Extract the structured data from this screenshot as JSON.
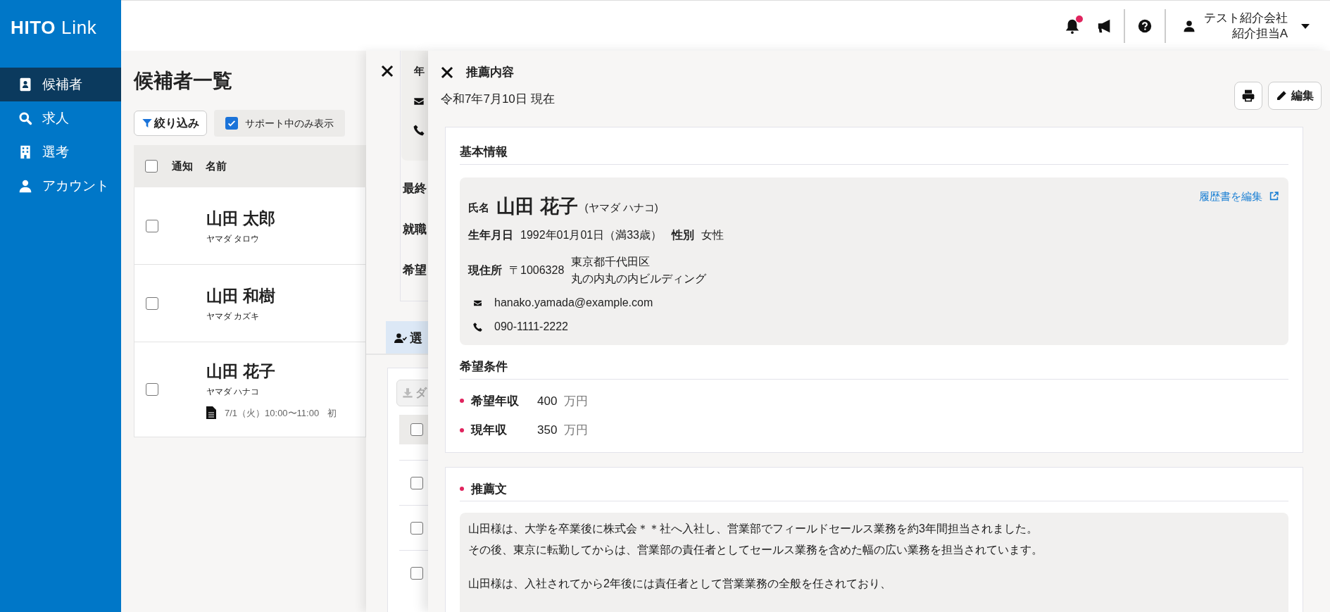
{
  "brand": {
    "logo": "**HITO** Link"
  },
  "sidebar": {
    "items": [
      {
        "label": "候補者",
        "selected": true
      },
      {
        "label": "求人",
        "selected": false
      },
      {
        "label": "選考",
        "selected": false
      },
      {
        "label": "アカウント",
        "selected": false
      }
    ]
  },
  "header": {
    "notifications": {
      "unread": true
    },
    "account": {
      "company": "テスト紹介会社",
      "user": "紹介担当A"
    }
  },
  "list": {
    "title": "候補者一覧",
    "filter_button": "絞り込み",
    "support_only": {
      "label": "サポート中のみ表示",
      "checked": true
    },
    "columns": [
      "通知",
      "名前"
    ],
    "header_checked": false,
    "rows": [
      {
        "name": "山田 太郎",
        "kana": "ヤマダ タロウ",
        "checked": false
      },
      {
        "name": "山田 和樹",
        "kana": "ヤマダ カズキ",
        "checked": false
      },
      {
        "name": "山田 花子",
        "kana": "ヤマダ ハナコ",
        "checked": false,
        "schedule": "7/1（火）10:00〜11:00",
        "note": "初"
      }
    ]
  },
  "back_drawer": {
    "header_fragment": "年",
    "labels": [
      "最終",
      "就職",
      "希望"
    ],
    "tab": "選",
    "download_button": "ダ",
    "header_checked": false,
    "rows": [
      {
        "checked": false
      },
      {
        "checked": false
      },
      {
        "checked": false
      }
    ]
  },
  "drawer": {
    "title": "推薦内容",
    "as_of": "令和7年7月10日 現在",
    "edit_button": "編集",
    "basic": {
      "heading": "基本情報",
      "name_label": "氏名",
      "name": "山田 花子",
      "kana": "(ヤマダ ハナコ)",
      "resume_link": "履歴書を編集",
      "birth_label": "生年月日",
      "birth": "1992年01月01日（満33歳）",
      "gender_label": "性別",
      "gender": "女性",
      "address_label": "現住所",
      "postal": "〒1006328",
      "address_lines": [
        "東京都千代田区",
        "丸の内丸の内ビルディング"
      ],
      "email": "hanako.yamada@example.com",
      "phone": "090-1111-2222"
    },
    "preferences": {
      "heading": "希望条件",
      "items": [
        {
          "label": "希望年収",
          "value": "400",
          "unit": "万円"
        },
        {
          "label": "現年収",
          "value": "350",
          "unit": "万円"
        }
      ]
    },
    "recommendation": {
      "heading": "推薦文",
      "paragraphs": [
        [
          "山田様は、大学を卒業後に株式会＊＊社へ入社し、営業部でフィールドセールス業務を約3年間担当されました。",
          "その後、東京に転勤してからは、営業部の責任者としてセールス業務を含めた幅の広い業務を担当されています。"
        ],
        [
          "山田様は、入社されてから2年後には責任者として営業業務の全般を任されており、"
        ]
      ]
    }
  }
}
